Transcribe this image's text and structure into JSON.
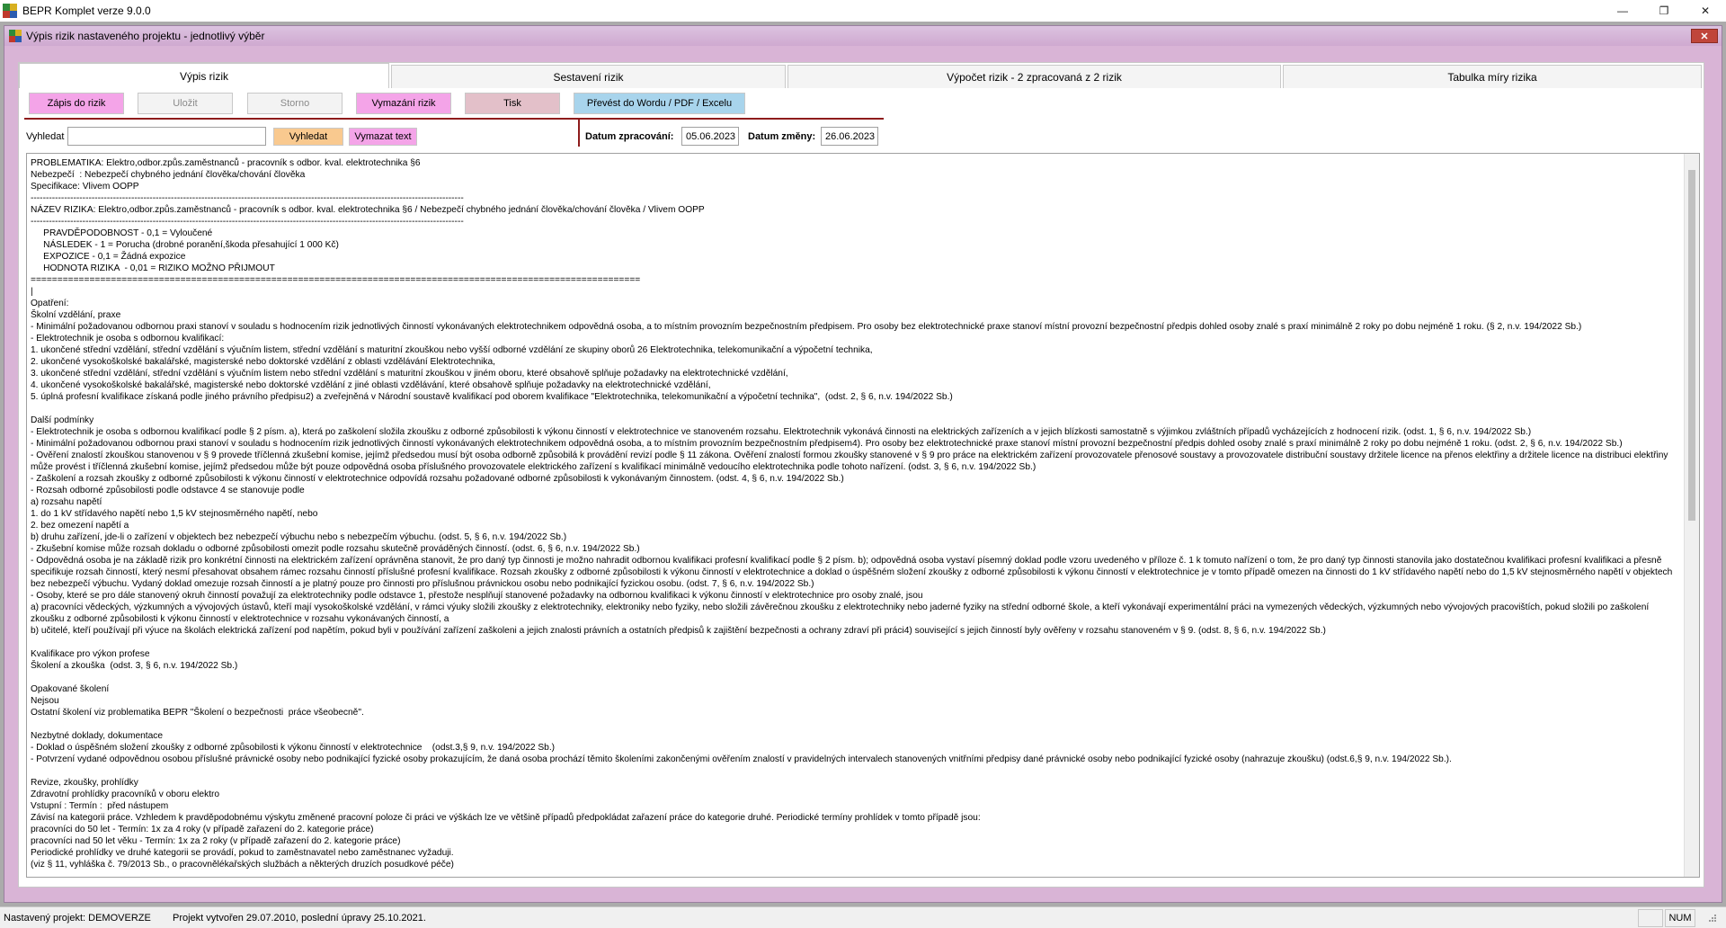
{
  "app": {
    "title": "BEPR Komplet verze 9.0.0",
    "controls": [
      "—",
      "❐",
      "✕"
    ]
  },
  "child": {
    "title": "Výpis rizik nastaveného projektu - jednotlivý výběr",
    "close": "✕"
  },
  "tabs": [
    "Výpis rizik",
    "Sestavení rizik",
    "Výpočet rizik - 2 zpracovaná z 2 rizik",
    "Tabulka míry rizika"
  ],
  "toolbar": {
    "zapis": "Zápis do rizik",
    "ulozit": "Uložit",
    "storno": "Storno",
    "vymazani": "Vymazání rizik",
    "tisk": "Tisk",
    "prevest": "Převést do Wordu / PDF / Excelu"
  },
  "search": {
    "label": "Vyhledat",
    "value": "",
    "find_btn": "Vyhledat",
    "clear_btn": "Vymazat text"
  },
  "dates": {
    "processed_label": "Datum zpracování:",
    "processed_value": "05.06.2023",
    "changed_label": "Datum změny:",
    "changed_value": "26.06.2023"
  },
  "content": "PROBLEMATIKA: Elektro,odbor.způs.zaměstnanců - pracovník s odbor. kval. elektrotechnika §6\nNebezpečí  : Nebezpečí chybného jednání člověka/chování člověka\nSpecifikace: Vlivem OOPP\n----------------------------------------------------------------------------------------------------------------------------------------------\nNÁZEV RIZIKA: Elektro,odbor.způs.zaměstnanců - pracovník s odbor. kval. elektrotechnika §6 / Nebezpečí chybného jednání člověka/chování člověka / Vlivem OOPP\n----------------------------------------------------------------------------------------------------------------------------------------------\n     PRAVDĚPODOBNOST - 0,1 = Vyloučené\n     NÁSLEDEK - 1 = Porucha (drobné poranění,škoda přesahující 1 000 Kč)\n     EXPOZICE - 0,1 = Žádná expozice\n     HODNOTA RIZIKA  - 0,01 = RIZIKO MOŽNO PŘIJMOUT\n==================================================================================================================\n|\nOpatření:\nŠkolní vzdělání, praxe\n- Minimální požadovanou odbornou praxi stanoví v souladu s hodnocením rizik jednotlivých činností vykonávaných elektrotechnikem odpovědná osoba, a to místním provozním bezpečnostním předpisem. Pro osoby bez elektrotechnické praxe stanoví místní provozní bezpečnostní předpis dohled osoby znalé s praxí minimálně 2 roky po dobu nejméně 1 roku. (§ 2, n.v. 194/2022 Sb.)\n- Elektrotechnik je osoba s odbornou kvalifikací:\n1. ukončené střední vzdělání, střední vzdělání s výučním listem, střední vzdělání s maturitní zkouškou nebo vyšší odborné vzdělání ze skupiny oborů 26 Elektrotechnika, telekomunikační a výpočetní technika,\n2. ukončené vysokoškolské bakalářské, magisterské nebo doktorské vzdělání z oblasti vzdělávání Elektrotechnika,\n3. ukončené střední vzdělání, střední vzdělání s výučním listem nebo střední vzdělání s maturitní zkouškou v jiném oboru, které obsahově splňuje požadavky na elektrotechnické vzdělání,\n4. ukončené vysokoškolské bakalářské, magisterské nebo doktorské vzdělání z jiné oblasti vzdělávání, které obsahově splňuje požadavky na elektrotechnické vzdělání,\n5. úplná profesní kvalifikace získaná podle jiného právního předpisu2) a zveřejněná v Národní soustavě kvalifikací pod oborem kvalifikace \"Elektrotechnika, telekomunikační a výpočetní technika\",  (odst. 2, § 6, n.v. 194/2022 Sb.)\n\nDalší podmínky\n- Elektrotechnik je osoba s odbornou kvalifikací podle § 2 písm. a), která po zaškolení složila zkoušku z odborné způsobilosti k výkonu činností v elektrotechnice ve stanoveném rozsahu. Elektrotechnik vykonává činnosti na elektrických zařízeních a v jejich blízkosti samostatně s výjimkou zvláštních případů vycházejících z hodnocení rizik. (odst. 1, § 6, n.v. 194/2022 Sb.)\n- Minimální požadovanou odbornou praxi stanoví v souladu s hodnocením rizik jednotlivých činností vykonávaných elektrotechnikem odpovědná osoba, a to místním provozním bezpečnostním předpisem4). Pro osoby bez elektrotechnické praxe stanoví místní provozní bezpečnostní předpis dohled osoby znalé s praxí minimálně 2 roky po dobu nejméně 1 roku. (odst. 2, § 6, n.v. 194/2022 Sb.)\n- Ověření znalostí zkouškou stanovenou v § 9 provede tříčlenná zkušební komise, jejímž předsedou musí být osoba odborně způsobilá k provádění revizí podle § 11 zákona. Ověření znalostí formou zkoušky stanovené v § 9 pro práce na elektrickém zařízení provozovatele přenosové soustavy a provozovatele distribuční soustavy držitele licence na přenos elektřiny a držitele licence na distribuci elektřiny může provést i tříčlenná zkušební komise, jejímž předsedou může být pouze odpovědná osoba příslušného provozovatele elektrického zařízení s kvalifikací minimálně vedoucího elektrotechnika podle tohoto nařízení. (odst. 3, § 6, n.v. 194/2022 Sb.)\n- Zaškolení a rozsah zkoušky z odborné způsobilosti k výkonu činností v elektrotechnice odpovídá rozsahu požadované odborné způsobilosti k vykonávaným činnostem. (odst. 4, § 6, n.v. 194/2022 Sb.)\n- Rozsah odborné způsobilosti podle odstavce 4 se stanovuje podle\na) rozsahu napětí\n1. do 1 kV střídavého napětí nebo 1,5 kV stejnosměrného napětí, nebo\n2. bez omezení napětí a\nb) druhu zařízení, jde-li o zařízení v objektech bez nebezpečí výbuchu nebo s nebezpečím výbuchu. (odst. 5, § 6, n.v. 194/2022 Sb.)\n- Zkušební komise může rozsah dokladu o odborné způsobilosti omezit podle rozsahu skutečně prováděných činností. (odst. 6, § 6, n.v. 194/2022 Sb.)\n- Odpovědná osoba je na základě rizik pro konkrétní činnosti na elektrickém zařízení oprávněna stanovit, že pro daný typ činnosti je možno nahradit odbornou kvalifikaci profesní kvalifikací podle § 2 písm. b); odpovědná osoba vystaví písemný doklad podle vzoru uvedeného v příloze č. 1 k tomuto nařízení o tom, že pro daný typ činnosti stanovila jako dostatečnou kvalifikaci profesní kvalifikaci a přesně specifikuje rozsah činností, který nesmí přesahovat obsahem rámec rozsahu činností příslušné profesní kvalifikace. Rozsah zkoušky z odborné způsobilosti k výkonu činností v elektrotechnice a doklad o úspěšném složení zkoušky z odborné způsobilosti k výkonu činností v elektrotechnice je v tomto případě omezen na činnosti do 1 kV střídavého napětí nebo do 1,5 kV stejnosměrného napětí v objektech bez nebezpečí výbuchu. Vydaný doklad omezuje rozsah činností a je platný pouze pro činnosti pro příslušnou právnickou osobu nebo podnikající fyzickou osobu. (odst. 7, § 6, n.v. 194/2022 Sb.)\n- Osoby, které se pro dále stanovený okruh činností považují za elektrotechniky podle odstavce 1, přestože nesplňují stanovené požadavky na odbornou kvalifikaci k výkonu činností v elektrotechnice pro osoby znalé, jsou\na) pracovníci vědeckých, výzkumných a vývojových ústavů, kteří mají vysokoškolské vzdělání, v rámci výuky složili zkoušky z elektrotechniky, elektroniky nebo fyziky, nebo složili závěrečnou zkoušku z elektrotechniky nebo jaderné fyziky na střední odborné škole, a kteří vykonávají experimentální práci na vymezených vědeckých, výzkumných nebo vývojových pracovištích, pokud složili po zaškolení zkoušku z odborné způsobilosti k výkonu činností v elektrotechnice v rozsahu vykonávaných činností, a\nb) učitelé, kteří používají při výuce na školách elektrická zařízení pod napětím, pokud byli v používání zařízení zaškoleni a jejich znalosti právních a ostatních předpisů k zajištění bezpečnosti a ochrany zdraví při práci4) související s jejich činností byly ověřeny v rozsahu stanoveném v § 9. (odst. 8, § 6, n.v. 194/2022 Sb.)\n\nKvalifikace pro výkon profese\nŠkolení a zkouška  (odst. 3, § 6, n.v. 194/2022 Sb.)\n\nOpakované školení\nNejsou\nOstatní školení viz problematika BEPR \"Školení o bezpečnosti  práce všeobecně\".\n\nNezbytné doklady, dokumentace\n- Doklad o úspěšném složení zkoušky z odborné způsobilosti k výkonu činností v elektrotechnice    (odst.3,§ 9, n.v. 194/2022 Sb.)\n- Potvrzení vydané odpovědnou osobou příslušné právnické osoby nebo podnikající fyzické osoby prokazujícím, že daná osoba prochází těmito školeními zakončenými ověřením znalostí v pravidelných intervalech stanovených vnitřními předpisy dané právnické osoby nebo podnikající fyzické osoby (nahrazuje zkoušku) (odst.6,§ 9, n.v. 194/2022 Sb.).\n\nRevize, zkoušky, prohlídky\nZdravotní prohlídky pracovníků v oboru elektro\nVstupní : Termín :  před nástupem\nZávisí na kategorii práce. Vzhledem k pravděpodobnému výskytu změnené pracovní poloze či práci ve výškách lze ve většině případů předpokládat zařazení práce do kategorie druhé. Periodické termíny prohlídek v tomto případě jsou:\npracovníci do 50 let - Termín: 1x za 4 roky (v případě zařazení do 2. kategorie práce)\npracovníci nad 50 let věku - Termín: 1x za 2 roky (v případě zařazení do 2. kategorie práce)\nPeriodické prohlídky ve druhé kategorii se provádí, pokud to zaměstnavatel nebo zaměstnanec vyžaduji.\n(viz § 11, vyhláška č. 79/2013 Sb., o pracovnělékařských službách a některých druzích posudkové péče)",
  "status": {
    "project": "Nastavený projekt: DEMOVERZE",
    "created": "Projekt vytvořen 29.07.2010, poslední úpravy 25.10.2021.",
    "num": "NUM"
  }
}
